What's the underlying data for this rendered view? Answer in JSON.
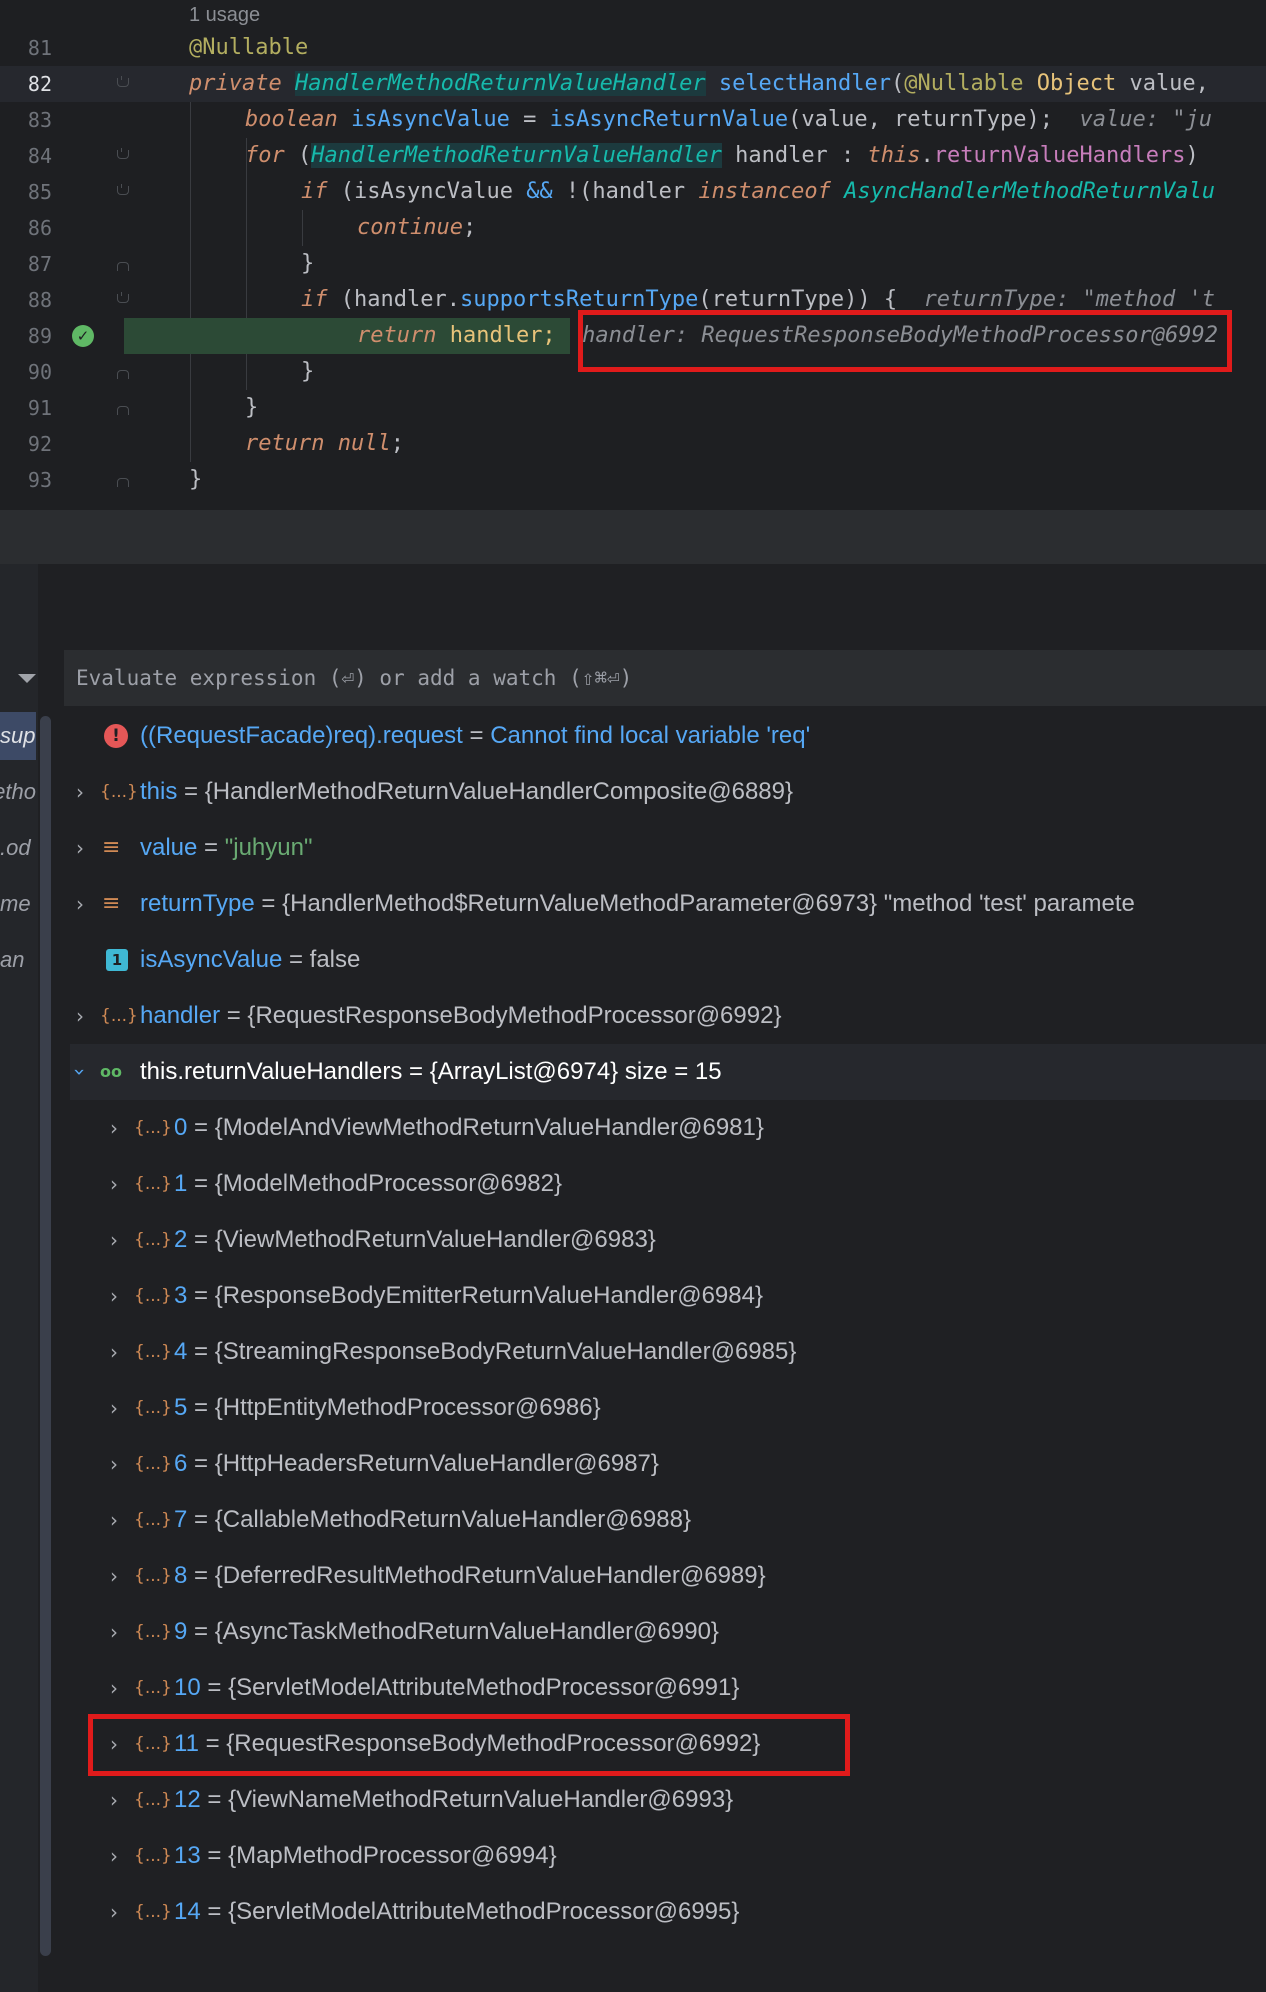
{
  "editor": {
    "usage_hint": "1 usage",
    "lines": [
      {
        "num": "81"
      },
      {
        "num": "82"
      },
      {
        "num": "83"
      },
      {
        "num": "84"
      },
      {
        "num": "85"
      },
      {
        "num": "86"
      },
      {
        "num": "87"
      },
      {
        "num": "88"
      },
      {
        "num": "89"
      },
      {
        "num": "90"
      },
      {
        "num": "91"
      },
      {
        "num": "92"
      },
      {
        "num": "93"
      }
    ],
    "code": {
      "l81_annotation": "@Nullable",
      "l82_private": "private ",
      "l82_type": "HandlerMethodReturnValueHandler",
      "l82_method": " selectHandler",
      "l82_paren": "(",
      "l82_annotation": "@Nullable ",
      "l82_object": "Object",
      "l82_rest": " value,",
      "l83_boolean": "boolean ",
      "l83_var": "isAsyncValue",
      "l83_eq": " = ",
      "l83_call": "isAsyncReturnValue",
      "l83_args": "(value, returnType);  ",
      "l83_hint": "value: \"ju",
      "l84_for": "for ",
      "l84_paren": "(",
      "l84_type": "HandlerMethodReturnValueHandler",
      "l84_handler": " handler : ",
      "l84_this": "this",
      "l84_dot": ".",
      "l84_field": "returnValueHandlers",
      "l84_close": ") ",
      "l85_if": "if ",
      "l85_cond": "(isAsyncValue ",
      "l85_op": "&&",
      "l85_not": " !(handler ",
      "l85_instanceof": "instanceof ",
      "l85_type": "AsyncHandlerMethodReturnValu",
      "l86_continue": "continue",
      "l86_semi": ";",
      "l87_brace": "}",
      "l88_if": "if ",
      "l88_open": "(handler.",
      "l88_method": "supportsReturnType",
      "l88_args": "(returnType)) {  ",
      "l88_hint": "returnType: \"method 't",
      "l89_return": "return ",
      "l89_handler": "handler;  ",
      "l89_hint": "handler: RequestResponseBodyMethodProcessor@6992",
      "l90_brace": "}",
      "l91_brace": "}",
      "l92_return": "return ",
      "l92_null": "null",
      "l92_semi": ";",
      "l93_brace": "}"
    }
  },
  "debugger": {
    "eval_placeholder": "Evaluate expression (⏎) or add a watch (⇧⌘⏎)",
    "side_labels": [
      "sup",
      "etho",
      "od.",
      "me",
      "an"
    ],
    "variables": [
      {
        "icon": "!",
        "name": "((RequestFacade)req).request",
        "eq": " = ",
        "value": "Cannot find local variable 'req'"
      },
      {
        "icon": "{...}",
        "name": "this",
        "eq": " = ",
        "value": "{HandlerMethodReturnValueHandlerComposite@6889}"
      },
      {
        "icon": "≡",
        "name": "value",
        "eq": " = ",
        "value": "\"juhyun\""
      },
      {
        "icon": "≡",
        "name": "returnType",
        "eq": " = ",
        "value": "{HandlerMethod$ReturnValueMethodParameter@6973} \"method 'test' paramete"
      },
      {
        "icon": "1",
        "name": "isAsyncValue",
        "eq": " = ",
        "value": "false"
      },
      {
        "icon": "{...}",
        "name": "handler",
        "eq": " = ",
        "value": "{RequestResponseBodyMethodProcessor@6992}"
      },
      {
        "icon": "oo",
        "name": "this.returnValueHandlers",
        "eq": " = ",
        "value": "{ArrayList@6974}  size = 15"
      }
    ],
    "children": [
      {
        "index": "0",
        "value": "{ModelAndViewMethodReturnValueHandler@6981}"
      },
      {
        "index": "1",
        "value": "{ModelMethodProcessor@6982}"
      },
      {
        "index": "2",
        "value": "{ViewMethodReturnValueHandler@6983}"
      },
      {
        "index": "3",
        "value": "{ResponseBodyEmitterReturnValueHandler@6984}"
      },
      {
        "index": "4",
        "value": "{StreamingResponseBodyReturnValueHandler@6985}"
      },
      {
        "index": "5",
        "value": "{HttpEntityMethodProcessor@6986}"
      },
      {
        "index": "6",
        "value": "{HttpHeadersReturnValueHandler@6987}"
      },
      {
        "index": "7",
        "value": "{CallableMethodReturnValueHandler@6988}"
      },
      {
        "index": "8",
        "value": "{DeferredResultMethodReturnValueHandler@6989}"
      },
      {
        "index": "9",
        "value": "{AsyncTaskMethodReturnValueHandler@6990}"
      },
      {
        "index": "10",
        "value": "{ServletModelAttributeMethodProcessor@6991}"
      },
      {
        "index": "11",
        "value": "{RequestResponseBodyMethodProcessor@6992}"
      },
      {
        "index": "12",
        "value": "{ViewNameMethodReturnValueHandler@6993}"
      },
      {
        "index": "13",
        "value": "{MapMethodProcessor@6994}"
      },
      {
        "index": "14",
        "value": "{ServletModelAttributeMethodProcessor@6995}"
      }
    ],
    "child_eq": " = ",
    "child_icon": "{...}"
  }
}
